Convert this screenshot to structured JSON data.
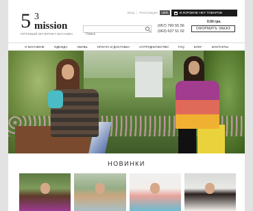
{
  "logo": {
    "number": "5",
    "superscript": "3",
    "word": "mission",
    "tagline": "ОПТОВЫЙ ИНТЕРНЕТ-МАГАЗИН"
  },
  "top_links": {
    "login": "Вход",
    "register": "Регистрация",
    "lang_active": "UKR",
    "lang_inactive": "RU"
  },
  "cart": {
    "label": "В КОРЗИНЕ НЕТ ТОВАРОВ"
  },
  "search": {
    "placeholder": "Поиск"
  },
  "phones": [
    "(067) 790 55 56",
    "(063) 637 51 02"
  ],
  "total": "0.00 грн.",
  "order_button": "ОФОРМИТЬ ЗАКАЗ",
  "nav": [
    "О МАГАЗИНЕ",
    "ОДЕЖДА",
    "ОБУВЬ",
    "ОПЛАТА И ДОСТАВКА",
    "СОТРУДНИЧЕСТВО",
    "FAQ",
    "БЛОГ",
    "КОНТАКТЫ"
  ],
  "section_title": "НОВИНКИ"
}
